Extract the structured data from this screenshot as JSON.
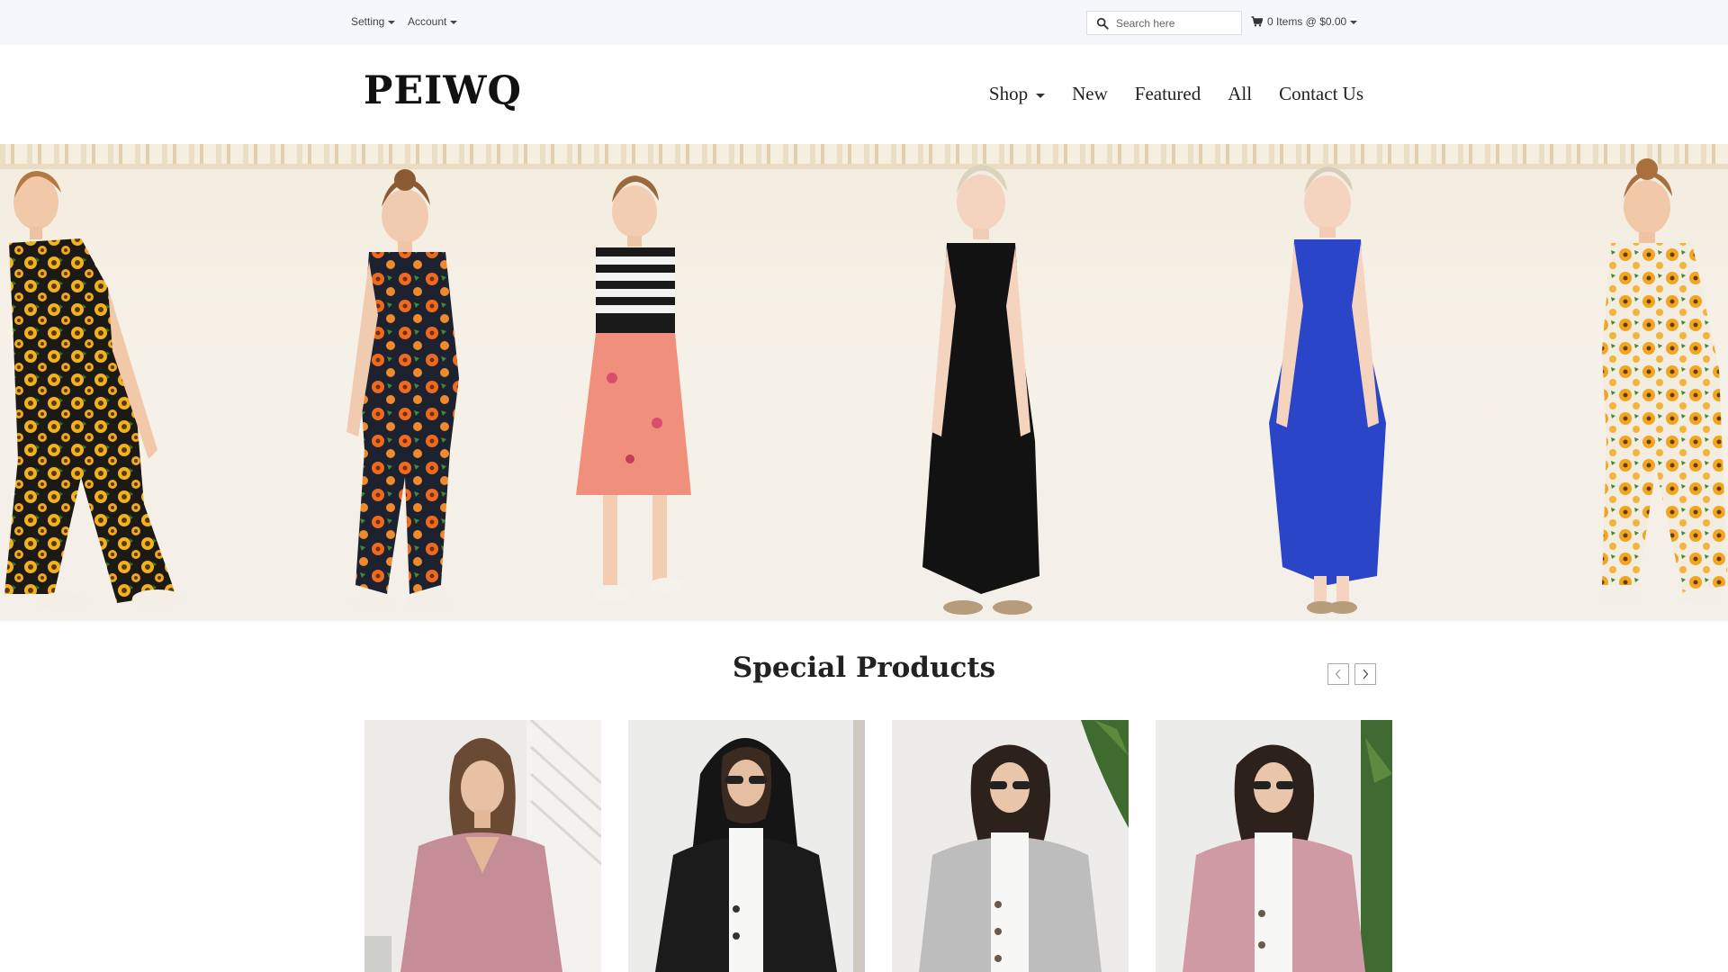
{
  "topbar": {
    "setting_label": "Setting",
    "account_label": "Account",
    "search_placeholder": "Search here",
    "cart_label": "0 Items @ $0.00"
  },
  "header": {
    "logo": "PEIWQ",
    "nav": {
      "shop": "Shop",
      "new": "New",
      "featured": "Featured",
      "all": "All",
      "contact": "Contact Us"
    }
  },
  "special": {
    "title": "Special Products"
  },
  "icons": {
    "search": "search-icon",
    "cart": "shopping-cart-icon",
    "prev": "chevron-left-icon",
    "next": "chevron-right-icon",
    "dropdown": "caret-down-icon"
  },
  "colors": {
    "topbar_bg": "#f6f7fb",
    "text_dark": "#222222",
    "banner_bg": "#f4eee4"
  }
}
